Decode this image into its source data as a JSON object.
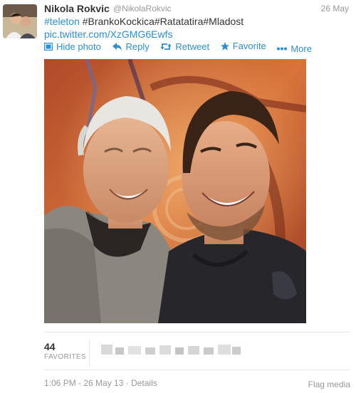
{
  "tweet": {
    "author_name": "Nikola Rokvic",
    "author_handle": "@NikolaRokvic",
    "date": "26 May",
    "text_line1": {
      "hashtag_link": "#teleton",
      "rest": " #BrankoKockica#Ratatatira#Mladost"
    },
    "text_line2_link": "pic.twitter.com/XzGMG6Ewfs",
    "actions": {
      "hide_photo": "Hide photo",
      "reply": "Reply",
      "retweet": "Retweet",
      "favorite": "Favorite",
      "more": "More"
    },
    "stats": {
      "favorites_count": "44",
      "favorites_label": "FAVORITES"
    },
    "meta": {
      "timestamp": "1:06 PM - 26 May 13",
      "separator": " · ",
      "details": "Details"
    },
    "flag_media": "Flag media"
  },
  "colors": {
    "link": "#2b8fd6",
    "muted": "#999999",
    "text": "#333333"
  },
  "icons": {
    "hide_photo": "photo-icon",
    "reply": "reply-arrow-icon",
    "retweet": "retweet-icon",
    "favorite": "star-icon",
    "more": "ellipsis-icon"
  }
}
